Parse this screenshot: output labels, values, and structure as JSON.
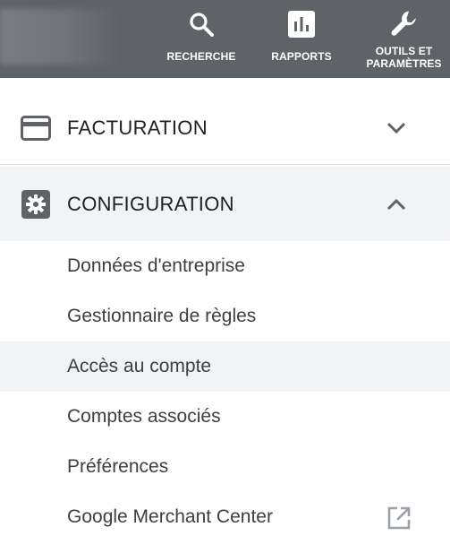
{
  "toolbar": {
    "search_label": "RECHERCHE",
    "reports_label": "RAPPORTS",
    "tools_label_line1": "OUTILS ET",
    "tools_label_line2": "PARAMÈTRES"
  },
  "sections": {
    "billing": {
      "label": "FACTURATION",
      "state": "collapsed",
      "icon": "credit-card-icon"
    },
    "configuration": {
      "label": "CONFIGURATION",
      "state": "expanded",
      "icon": "gear-icon"
    }
  },
  "menu_items": [
    {
      "label": "Données d'entreprise"
    },
    {
      "label": "Gestionnaire de règles"
    },
    {
      "label": "Accès au compte",
      "active": true
    },
    {
      "label": "Comptes associés"
    },
    {
      "label": "Préférences"
    },
    {
      "label": "Google Merchant Center",
      "icon": "open-in-new-icon"
    }
  ],
  "colors": {
    "topbar": "#5f6368",
    "active_bg": "#f1f3f4",
    "text": "#202124",
    "icon_gray": "#5f6368"
  }
}
